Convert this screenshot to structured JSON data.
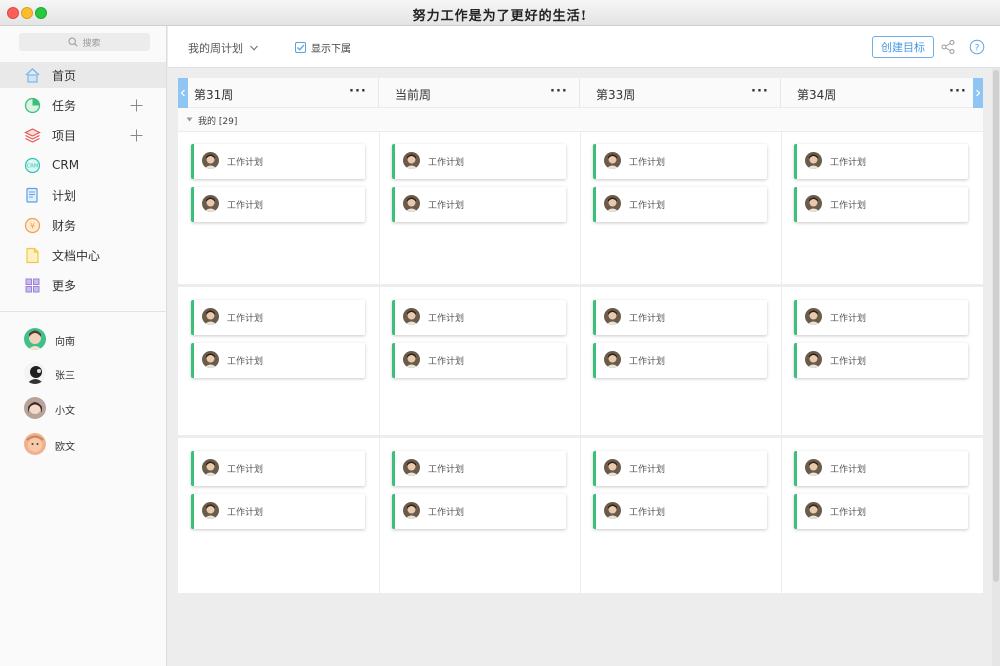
{
  "window": {
    "title": "努力工作是为了更好的生活!"
  },
  "sidebar": {
    "search_placeholder": "搜索",
    "items": [
      {
        "label": "首页",
        "icon": "home-icon",
        "color": "#7ab8ec",
        "active": true,
        "has_add": false
      },
      {
        "label": "任务",
        "icon": "pie-chart-icon",
        "color": "#3bbf7a",
        "active": false,
        "has_add": true
      },
      {
        "label": "项目",
        "icon": "layers-icon",
        "color": "#e8534f",
        "active": false,
        "has_add": true
      },
      {
        "label": "CRM",
        "icon": "crm-icon",
        "color": "#2ec4b6",
        "active": false,
        "has_add": false
      },
      {
        "label": "计划",
        "icon": "plan-icon",
        "color": "#5aa0e6",
        "active": false,
        "has_add": false
      },
      {
        "label": "财务",
        "icon": "finance-icon",
        "color": "#f0a04b",
        "active": false,
        "has_add": false
      },
      {
        "label": "文档中心",
        "icon": "document-icon",
        "color": "#f3c744",
        "active": false,
        "has_add": false
      },
      {
        "label": "更多",
        "icon": "grid-icon",
        "color": "#9b82d9",
        "active": false,
        "has_add": false
      }
    ],
    "contacts": [
      {
        "name": "向南",
        "icon": "avatar-icon"
      },
      {
        "name": "张三",
        "icon": "avatar-icon"
      },
      {
        "name": "小文",
        "icon": "avatar-icon"
      },
      {
        "name": "欧文",
        "icon": "avatar-icon"
      }
    ]
  },
  "toolbar": {
    "view_select": "我的周计划",
    "show_subordinates": {
      "label": "显示下属",
      "checked": true
    },
    "create_button": "创建目标",
    "share_icon": "share-icon",
    "help_icon": "help-icon"
  },
  "board": {
    "weeks": [
      {
        "title": "第31周",
        "more": "···"
      },
      {
        "title": "当前周",
        "more": "···"
      },
      {
        "title": "第33周",
        "more": "···"
      },
      {
        "title": "第34周",
        "more": "···"
      }
    ],
    "group_label": "我的 [29]",
    "card_label": "工作计划",
    "accent_color": "#3bbf7a",
    "rows": 3,
    "cards_per_cell": 2
  }
}
